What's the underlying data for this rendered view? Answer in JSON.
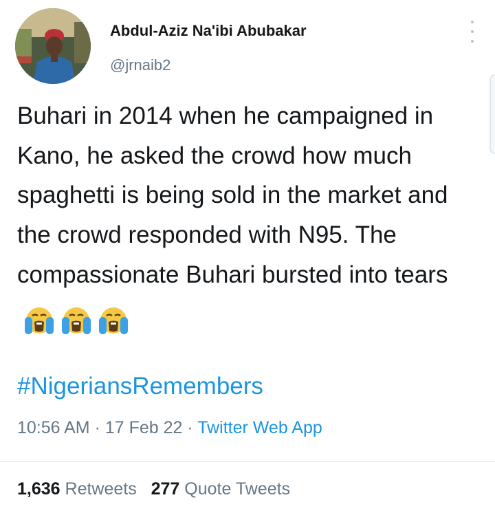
{
  "author": {
    "display_name": "Abdul-Aziz Na'ibi Abubakar",
    "handle": "@jrnaib2"
  },
  "tweet": {
    "text": "Buhari in 2014 when he campaigned in Kano, he asked the crowd how much spaghetti is being sold in the market and the crowd responded with N95. The compassionate Buhari bursted into tears",
    "emojis": [
      "loudly-crying-face",
      "loudly-crying-face",
      "loudly-crying-face"
    ],
    "hashtag": "#NigeriansRemembers"
  },
  "meta": {
    "time": "10:56 AM",
    "separator": " · ",
    "date": "17 Feb 22",
    "source": "Twitter Web App"
  },
  "stats": {
    "retweets_count": "1,636",
    "retweets_label": "Retweets",
    "quotes_count": "277",
    "quotes_label": "Quote Tweets"
  },
  "colors": {
    "link": "#1b95e0",
    "secondary_text": "#657786",
    "primary_text": "#14171a"
  }
}
